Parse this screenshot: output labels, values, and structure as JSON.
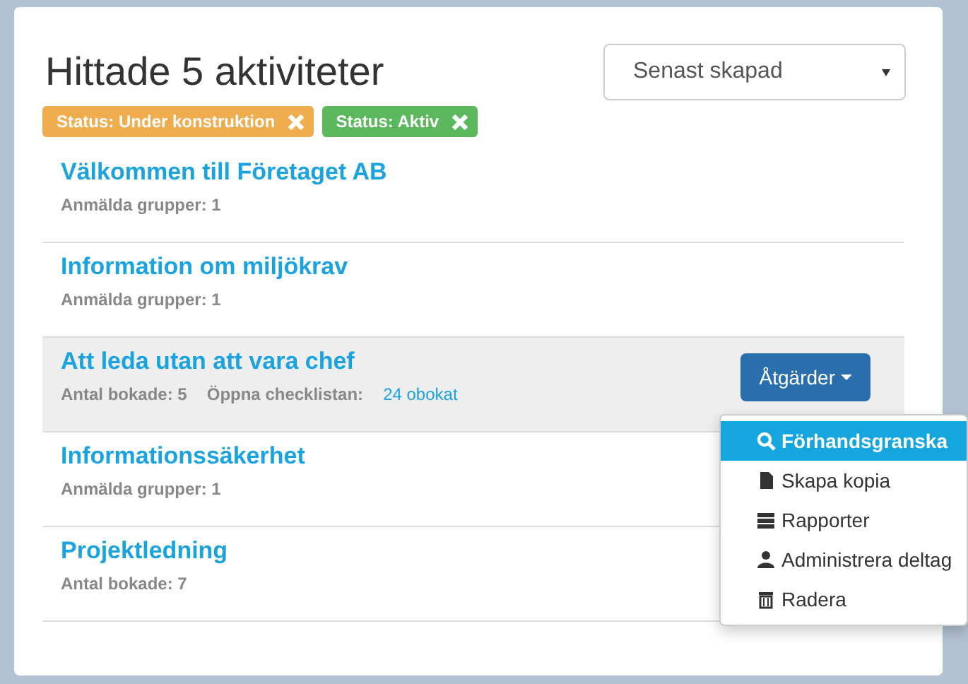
{
  "heading": "Hittade 5 aktiviteter",
  "sort_select": {
    "value": "Senast skapad"
  },
  "filters": [
    {
      "label": "Status: Under konstruktion",
      "color": "#f0ad4e"
    },
    {
      "label": "Status: Aktiv",
      "color": "#5cb85c"
    }
  ],
  "activities": [
    {
      "title": "Välkommen till Företaget AB",
      "highlighted": false,
      "meta": [
        {
          "kind": "text",
          "text": "Anmälda grupper: 1"
        }
      ]
    },
    {
      "title": "Information om miljökrav",
      "highlighted": false,
      "meta": [
        {
          "kind": "text",
          "text": "Anmälda grupper: 1"
        }
      ]
    },
    {
      "title": "Att leda utan att vara chef",
      "highlighted": true,
      "meta": [
        {
          "kind": "text",
          "text": "Antal bokade: 5"
        },
        {
          "kind": "text",
          "text": "Öppna checklistan:"
        },
        {
          "kind": "link",
          "text": "24 obokat"
        }
      ],
      "actions": {
        "label": "Åtgärder",
        "expanded": true,
        "menu": [
          {
            "kind": "search",
            "label": "Förhandsgranska",
            "selected": true
          },
          {
            "kind": "file",
            "label": "Skapa kopia",
            "selected": false
          },
          {
            "kind": "list",
            "label": "Rapporter",
            "selected": false
          },
          {
            "kind": "user",
            "label": "Administrera deltag",
            "selected": false
          },
          {
            "kind": "trash",
            "label": "Radera",
            "selected": false
          }
        ]
      }
    },
    {
      "title": "Informationssäkerhet",
      "highlighted": false,
      "meta": [
        {
          "kind": "text",
          "text": "Anmälda grupper: 1"
        }
      ]
    },
    {
      "title": "Projektledning",
      "highlighted": false,
      "meta": [
        {
          "kind": "text",
          "text": "Antal bokade: 7"
        }
      ]
    }
  ]
}
